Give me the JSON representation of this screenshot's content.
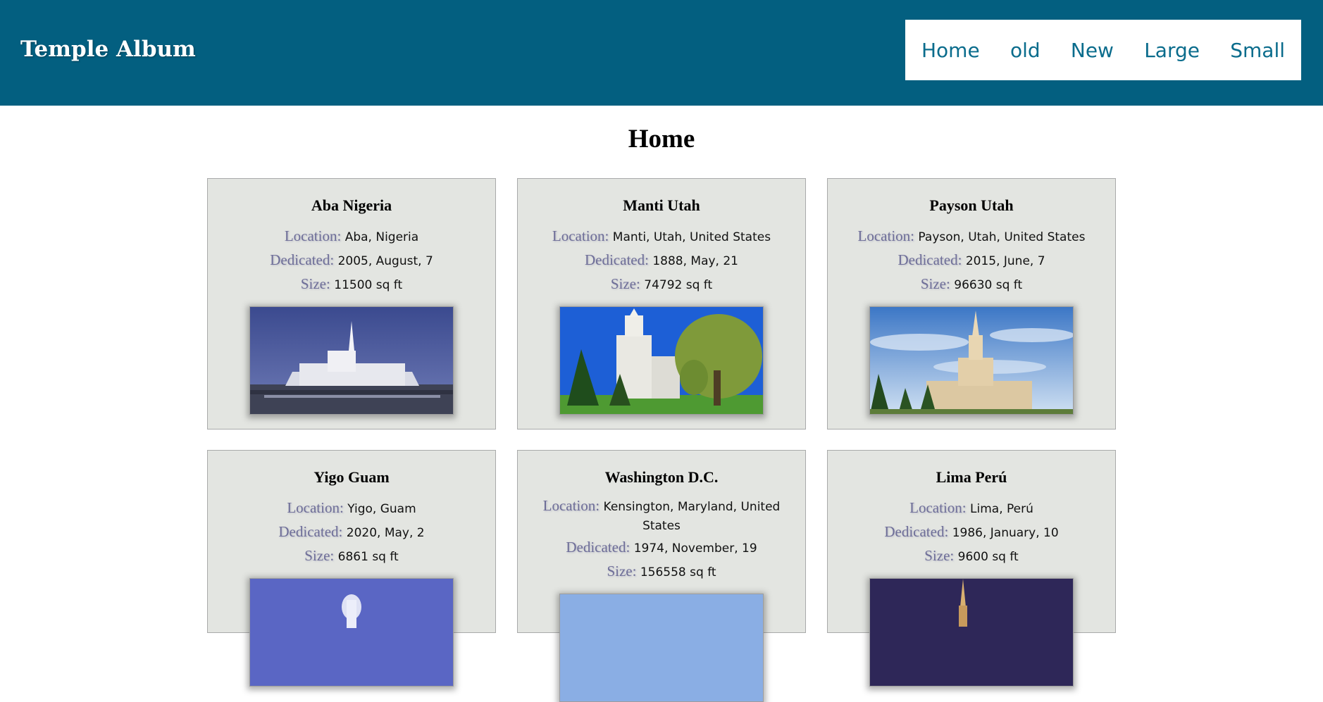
{
  "site": {
    "title": "Temple Album",
    "nav": [
      "Home",
      "old",
      "New",
      "Large",
      "Small"
    ]
  },
  "page": {
    "heading": "Home"
  },
  "labels": {
    "location": "Location:",
    "dedicated": "Dedicated:",
    "size": "Size:"
  },
  "temples": [
    {
      "name": "Aba Nigeria",
      "location": "Aba, Nigeria",
      "dedicated": "2005, August, 7",
      "size": "11500 sq ft"
    },
    {
      "name": "Manti Utah",
      "location": "Manti, Utah, United States",
      "dedicated": "1888, May, 21",
      "size": "74792 sq ft"
    },
    {
      "name": "Payson Utah",
      "location": "Payson, Utah, United States",
      "dedicated": "2015, June, 7",
      "size": "96630 sq ft"
    },
    {
      "name": "Yigo Guam",
      "location": "Yigo, Guam",
      "dedicated": "2020, May, 2",
      "size": "6861 sq ft"
    },
    {
      "name": "Washington D.C.",
      "location": "Kensington, Maryland, United States",
      "dedicated": "1974, November, 19",
      "size": "156558 sq ft"
    },
    {
      "name": "Lima Perú",
      "location": "Lima, Perú",
      "dedicated": "1986, January, 10",
      "size": "9600 sq ft"
    }
  ]
}
